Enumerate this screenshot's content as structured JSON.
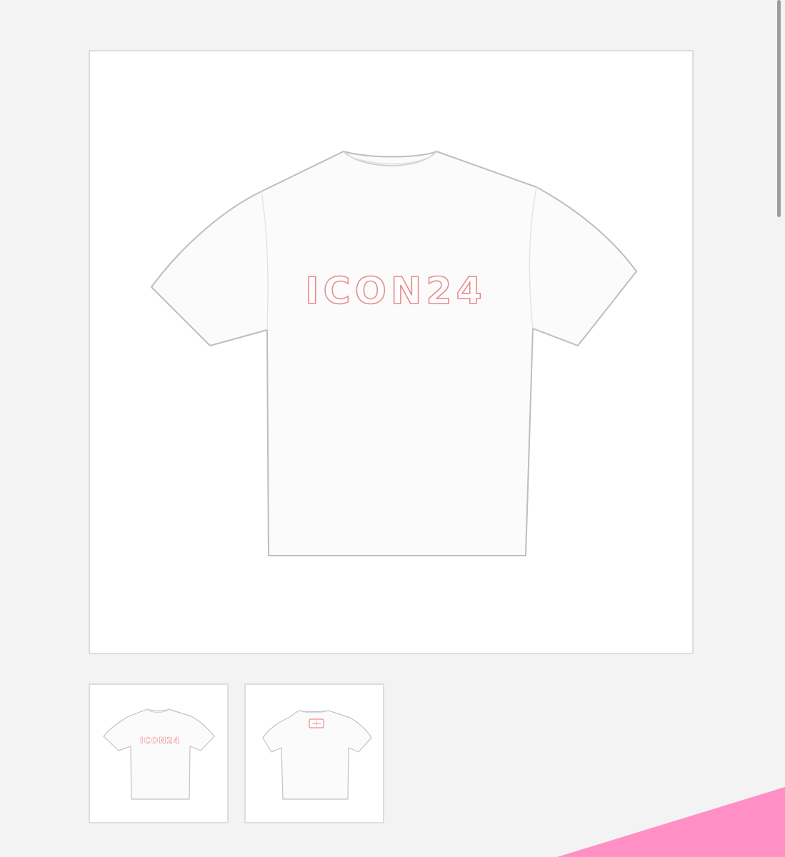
{
  "product": {
    "print_text": "ICON24",
    "main_image": {
      "view": "front"
    },
    "thumbnails": [
      {
        "view": "front",
        "selected": true
      },
      {
        "view": "back",
        "selected": false
      }
    ]
  },
  "colors": {
    "page_background": "#f3f3f4",
    "frame_border": "#dcdde2",
    "tshirt_fill": "#fbfbfc",
    "tshirt_outline": "#bdbdc2",
    "print_outline": "#e98c8c",
    "accent_pink": "#ff8fc4",
    "scrollbar": "#9b9ba0"
  }
}
